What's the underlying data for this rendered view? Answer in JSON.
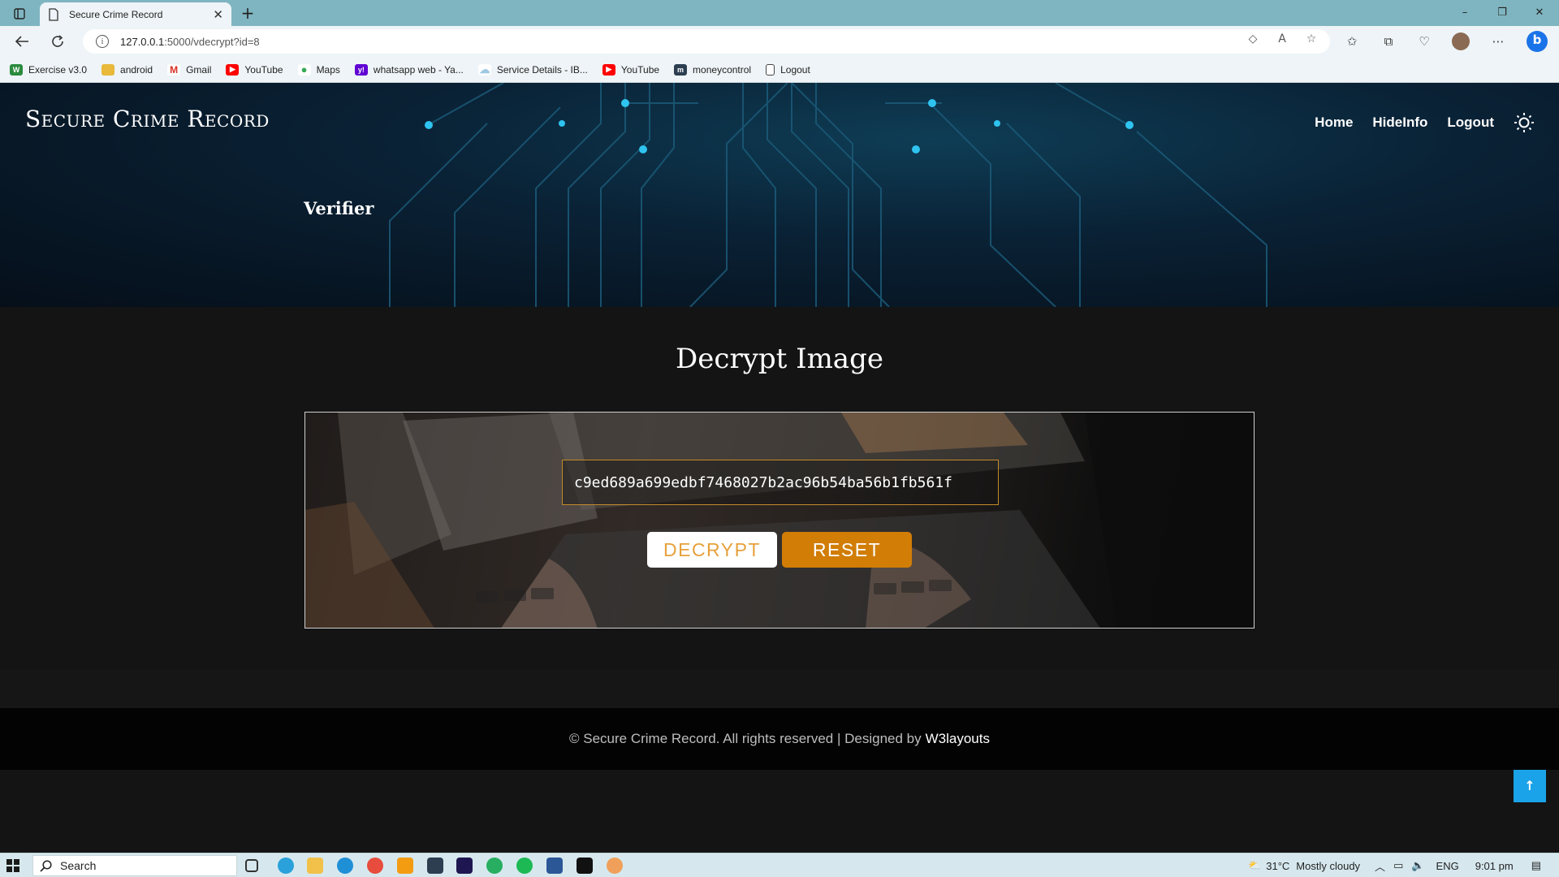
{
  "browser": {
    "tab_title": "Secure Crime Record",
    "url_host": "127.0.0.1",
    "url_path": ":5000/vdecrypt?id=8",
    "bookmarks": [
      {
        "label": "Exercise v3.0",
        "icon": "w-icon",
        "color": "#2b8a3e"
      },
      {
        "label": "android",
        "icon": "folder-icon",
        "color": "#e8b93a"
      },
      {
        "label": "Gmail",
        "icon": "gmail-icon",
        "color": "#d93025"
      },
      {
        "label": "YouTube",
        "icon": "youtube-icon",
        "color": "#ff0000"
      },
      {
        "label": "Maps",
        "icon": "maps-icon",
        "color": "#34a853"
      },
      {
        "label": "whatsapp web - Ya...",
        "icon": "yahoo-icon",
        "color": "#6001d2"
      },
      {
        "label": "Service Details - IB...",
        "icon": "cloud-icon",
        "color": "#9ec9e2"
      },
      {
        "label": "YouTube",
        "icon": "youtube-icon",
        "color": "#ff0000"
      },
      {
        "label": "moneycontrol",
        "icon": "moneycontrol-icon",
        "color": "#2c3e50"
      },
      {
        "label": "Logout",
        "icon": "page-icon",
        "color": "#ffffff"
      }
    ]
  },
  "site": {
    "brand": "Secure Crime Record",
    "nav": [
      "Home",
      "HideInfo",
      "Logout"
    ],
    "role": "Verifier"
  },
  "decrypt": {
    "title": "Decrypt Image",
    "key_value": "c9ed689a699edbf7468027b2ac96b54ba56b1fb561f",
    "decrypt_label": "DECRYPT",
    "reset_label": "RESET"
  },
  "footer": {
    "text": "© Secure Crime Record. All rights reserved | Designed by",
    "link": "W3layouts"
  },
  "taskbar": {
    "search_label": "Search",
    "temperature": "31°C",
    "weather": "Mostly cloudy",
    "language": "ENG",
    "time": "9:01 pm"
  },
  "colors": {
    "accent_orange": "#d17d06",
    "input_border": "#c48a2a",
    "to_top_blue": "#1aa3e8"
  }
}
